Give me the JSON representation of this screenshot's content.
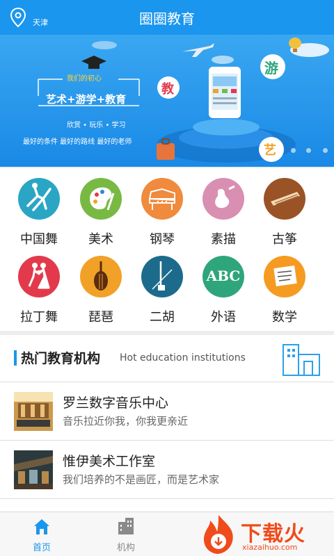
{
  "header": {
    "location": "天津",
    "title": "圈圈教育"
  },
  "banner": {
    "slogan_small": "我们的初心",
    "slogan_main": "艺术+游学+教育",
    "slogan_sub": "欣赏  •  玩乐  •  学习",
    "slogan_foot": "最好的条件  最好的路线  最好的老师",
    "badge_jiao": "教",
    "badge_you": "游",
    "badge_yi": "艺",
    "slide_count": 3
  },
  "categories": [
    {
      "label": "中国舞",
      "color": "#2aa6c4",
      "icon": "dancer-icon"
    },
    {
      "label": "美术",
      "color": "#78b944",
      "icon": "palette-icon"
    },
    {
      "label": "钢琴",
      "color": "#f08a3c",
      "icon": "piano-icon"
    },
    {
      "label": "素描",
      "color": "#d98fb1",
      "icon": "sketch-icon"
    },
    {
      "label": "古筝",
      "color": "#9a5227",
      "icon": "guzheng-icon"
    },
    {
      "label": "拉丁舞",
      "color": "#e23a4c",
      "icon": "latin-dance-icon"
    },
    {
      "label": "琵琶",
      "color": "#f2a128",
      "icon": "pipa-icon"
    },
    {
      "label": "二胡",
      "color": "#1d6b8c",
      "icon": "erhu-icon"
    },
    {
      "label": "外语",
      "color": "#2fa57c",
      "icon": "abc-icon",
      "text": "ABC"
    },
    {
      "label": "数学",
      "color": "#f59b22",
      "icon": "math-icon"
    }
  ],
  "section": {
    "title": "热门教育机构",
    "subtitle": "Hot education institutions"
  },
  "institutions": [
    {
      "name": "罗兰数字音乐中心",
      "desc": "音乐拉近你我，你我更亲近"
    },
    {
      "name": "惟伊美术工作室",
      "desc": "我们培养的不是画匠，而是艺术家"
    }
  ],
  "tabs": [
    {
      "label": "首页",
      "active": true,
      "color": "#1a96ee"
    },
    {
      "label": "机构",
      "active": false,
      "color": "#888888"
    }
  ],
  "watermark": {
    "brand": "下载火",
    "url": "xiazaihuo.com"
  }
}
